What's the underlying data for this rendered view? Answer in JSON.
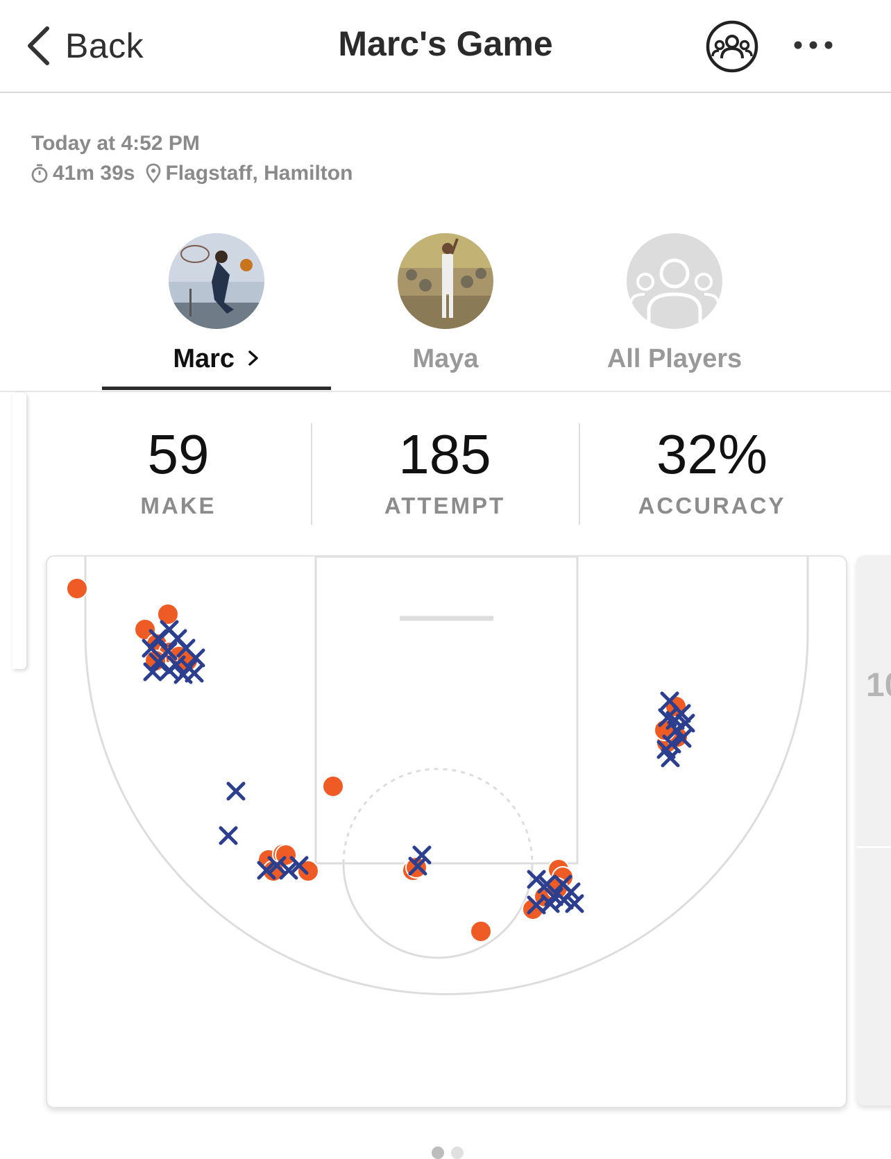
{
  "header": {
    "back_label": "Back",
    "title": "Marc's Game",
    "group_icon": "group-icon",
    "more_icon": "more-dots-icon"
  },
  "meta": {
    "date": "Today at 4:52 PM",
    "duration": "41m 39s",
    "location": "Flagstaff, Hamilton"
  },
  "players": [
    {
      "name": "Marc",
      "active": true
    },
    {
      "name": "Maya",
      "active": false
    },
    {
      "name": "All Players",
      "active": false
    }
  ],
  "stats": [
    {
      "value": "59",
      "label": "MAKE"
    },
    {
      "value": "185",
      "label": "ATTEMPT"
    },
    {
      "value": "32%",
      "label": "ACCURACY"
    }
  ],
  "next_card_label": "10",
  "colors": {
    "make": "#ef5b24",
    "miss": "#2c3f8f",
    "court_line": "#dddddd"
  },
  "pager": {
    "pages": 2,
    "current": 0
  }
}
